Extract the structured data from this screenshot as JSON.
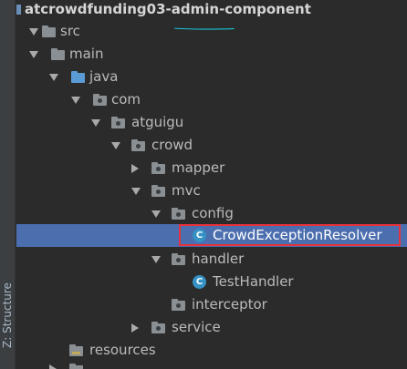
{
  "project": {
    "title": "atcrowdfunding03-admin-component"
  },
  "side_tab": {
    "label": "Z: Structure"
  },
  "tree": [
    {
      "label": "src"
    },
    {
      "label": "main"
    },
    {
      "label": "java"
    },
    {
      "label": "com"
    },
    {
      "label": "atguigu"
    },
    {
      "label": "crowd"
    },
    {
      "label": "mapper"
    },
    {
      "label": "mvc"
    },
    {
      "label": "config"
    },
    {
      "label": "CrowdExceptionResolver",
      "icon_glyph": "C"
    },
    {
      "label": "handler"
    },
    {
      "label": "TestHandler",
      "icon_glyph": "C"
    },
    {
      "label": "interceptor"
    },
    {
      "label": "service"
    },
    {
      "label": "resources"
    }
  ],
  "colors": {
    "background": "#2b2b2b",
    "selection": "#4b6eaf",
    "annotation_box": "#e6323c",
    "annotation_underline": "#19c2d6",
    "class_icon": "#3592c4",
    "source_folder": "#5b9bd5"
  }
}
